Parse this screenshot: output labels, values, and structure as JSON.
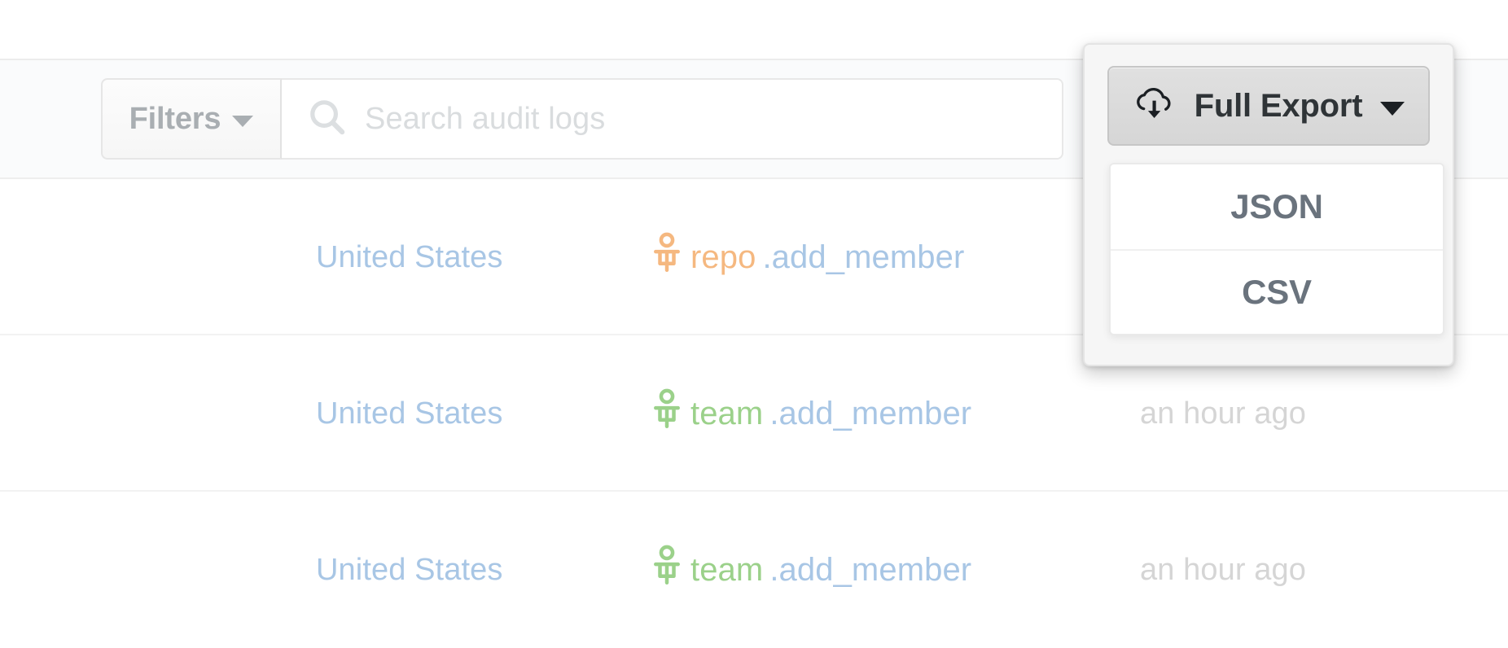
{
  "toolbar": {
    "filters_label": "Filters",
    "filters_icon": "chevron-down-icon",
    "search_icon": "search-icon",
    "search_placeholder": "Search audit logs",
    "search_value": ""
  },
  "export": {
    "button_label": "Full Export",
    "button_icon": "cloud-download-icon",
    "caret_icon": "chevron-down-icon",
    "menu_open": true,
    "menu_items": [
      {
        "label": "JSON"
      },
      {
        "label": "CSV"
      }
    ]
  },
  "table": {
    "rows": [
      {
        "country": "United States",
        "action_icon": "person-icon",
        "action_icon_color": "#f5b880",
        "action_scope": "repo",
        "action_rest": ".add_member",
        "time": ""
      },
      {
        "country": "United States",
        "action_icon": "person-icon",
        "action_icon_color": "#9bd18a",
        "action_scope": "team",
        "action_rest": ".add_member",
        "time": "an hour ago"
      },
      {
        "country": "United States",
        "action_icon": "person-icon",
        "action_icon_color": "#9bd18a",
        "action_scope": "team",
        "action_rest": ".add_member",
        "time": "an hour ago"
      }
    ]
  },
  "colors": {
    "link_blue": "#a8c6e5",
    "muted_gray": "#d5d5d5",
    "repo_orange": "#f5b880",
    "team_green": "#9bd18a",
    "toolbar_bg": "#fafbfc",
    "export_button_bg": "#dadada"
  }
}
